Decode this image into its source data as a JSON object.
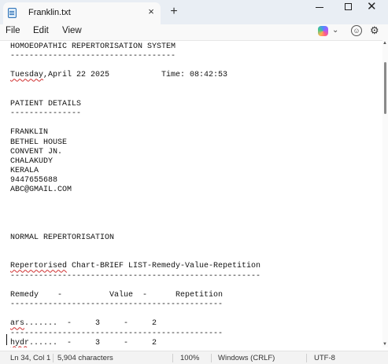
{
  "window": {
    "tab_title": "Franklin.txt",
    "close_tab_glyph": "×",
    "new_tab_glyph": "+",
    "minimize_glyph": "",
    "maximize_glyph": "",
    "close_glyph": "✕"
  },
  "menu": {
    "file": "File",
    "edit": "Edit",
    "view": "View",
    "copilot_icon": "copilot-icon",
    "account_icon": "account-icon",
    "settings_icon": "gear-icon"
  },
  "document": {
    "lines": [
      "HOMOEOPATHIC REPERTORISATION SYSTEM",
      "-----------------------------------",
      "",
      "Tuesday,April 22 2025           Time: 08:42:53",
      "",
      "",
      "PATIENT DETAILS",
      "---------------",
      "",
      "FRANKLIN",
      "BETHEL HOUSE",
      "CONVENT JN.",
      "CHALAKUDY",
      "KERALA",
      "9447655688",
      "ABC@GMAIL.COM",
      "",
      "",
      "",
      "",
      "NORMAL REPERTORISATION",
      "",
      "",
      "Repertorised Chart-BRIEF LIST-Remedy-Value-Repetition",
      "-----------------------------------------------------",
      "",
      "Remedy    -          Value  -      Repetition",
      "---------------------------------------------",
      "",
      "ars.......  -     3     -     2",
      "---------------------------------------------",
      "hydr......  -     3     -     2",
      "---------------------------------------------"
    ]
  },
  "status": {
    "position": "Ln 34, Col 1",
    "characters": "5,904 characters",
    "zoom": "100%",
    "line_ending": "Windows (CRLF)",
    "encoding": "UTF-8"
  }
}
